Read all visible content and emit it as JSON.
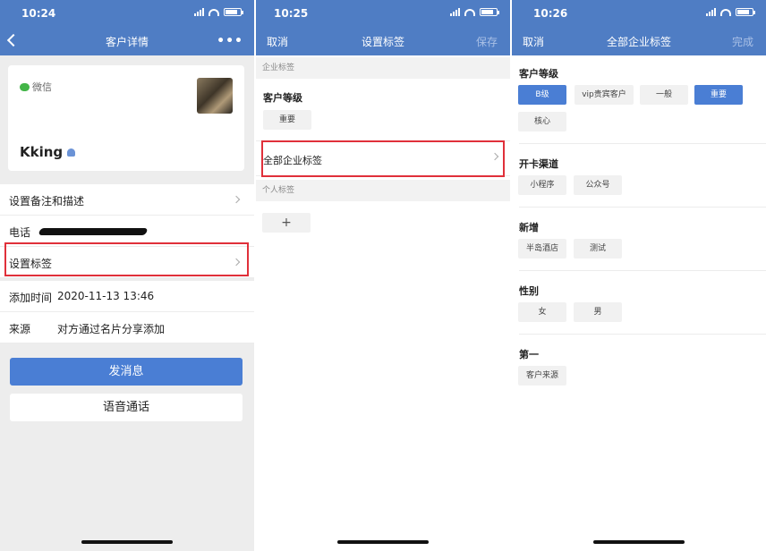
{
  "screen1": {
    "status_time": "10:24",
    "title": "客户详情",
    "more_label": "•••",
    "card": {
      "source_label": "微信",
      "name": "Kking"
    },
    "rows": [
      {
        "label": "设置备注和描述",
        "value": ""
      },
      {
        "label": "电话",
        "value": ""
      },
      {
        "label": "设置标签",
        "value": ""
      },
      {
        "label": "添加时间",
        "value": "2020-11-13 13:46"
      },
      {
        "label": "来源",
        "value": "对方通过名片分享添加"
      }
    ],
    "primary_button": "发消息",
    "secondary_button": "语音通话"
  },
  "screen2": {
    "status_time": "10:25",
    "left": "取消",
    "title": "设置标签",
    "right": "保存",
    "section_enterprise": "企业标签",
    "group_title": "客户等级",
    "group_tags": [
      "重要"
    ],
    "all_enterprise_row": "全部企业标签",
    "section_personal": "个人标签",
    "add_label": "+"
  },
  "screen3": {
    "status_time": "10:26",
    "left": "取消",
    "title": "全部企业标签",
    "right": "完成",
    "groups": [
      {
        "title": "客户等级",
        "tags": [
          {
            "label": "B级",
            "selected": true
          },
          {
            "label": "vip贵宾客户",
            "selected": false
          },
          {
            "label": "一般",
            "selected": false
          },
          {
            "label": "重要",
            "selected": true
          },
          {
            "label": "核心",
            "selected": false
          }
        ]
      },
      {
        "title": "开卡渠道",
        "tags": [
          {
            "label": "小程序",
            "selected": false
          },
          {
            "label": "公众号",
            "selected": false
          }
        ]
      },
      {
        "title": "新增",
        "tags": [
          {
            "label": "半岛酒店",
            "selected": false
          },
          {
            "label": "测试",
            "selected": false
          }
        ]
      },
      {
        "title": "性别",
        "tags": [
          {
            "label": "女",
            "selected": false
          },
          {
            "label": "男",
            "selected": false
          }
        ]
      },
      {
        "title": "第一",
        "tags": [
          {
            "label": "客户来源",
            "selected": false
          }
        ]
      }
    ]
  },
  "colors": {
    "header_blue": "#4f7dc4",
    "button_blue": "#4a7ed4",
    "highlight_red": "#e0303a",
    "wechat_green": "#43b548"
  }
}
